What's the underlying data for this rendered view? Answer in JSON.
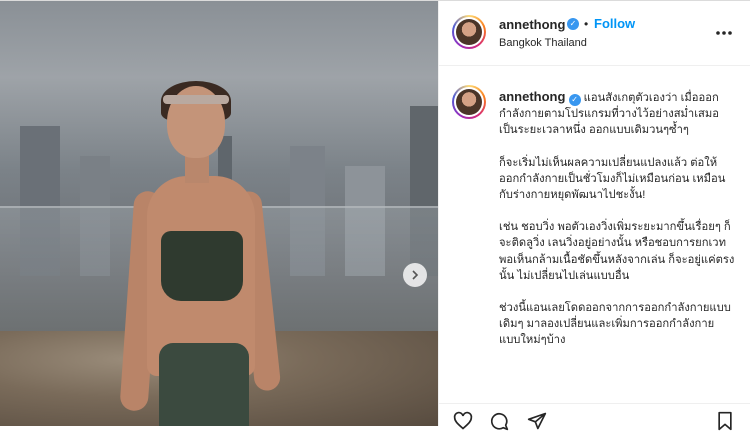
{
  "post": {
    "username": "annethong",
    "follow_label": "Follow",
    "separator": "•",
    "location": "Bangkok Thailand",
    "more_label": "•••"
  },
  "caption": {
    "username": "annethong",
    "p1": "แอนสังเกตุตัวเองว่า เมื่อออกกำลังกายตามโปรแกรมที่วางไว้อย่างสม่ำเสมอเป็นระยะเวลาหนึ่ง ออกแบบเดิมวนๆซ้ำๆ",
    "p2": "ก็จะเริ่มไม่เห็นผลความเปลี่ยนแปลงแล้ว ต่อให้ออกกำลังกายเป็นชั่วโมงก็ไม่เหมือนก่อน เหมือนกับร่างกายหยุดพัฒนาไปชะงั้น!",
    "p3": "เช่น ชอบวิ่ง พอตัวเองวิ่งเพิ่มระยะมากขึ้นเรื่อยๆ ก็จะติดลูวิ่ง เลนวิ่งอยู่อย่างนั้น หรือชอบการยกเวท พอเห็นกล้ามเนื้อชัดขึ้นหลังจากเล่น ก็จะอยู่แค่ตรงนั้น ไม่เปลี่ยนไปเล่นแบบอื่น",
    "p4": "ช่วงนี้แอนเลยโดดออกจากการออกกำลังกายแบบเดิมๆ มาลองเปลี่ยนและเพิ่มการออกกำลังกายแบบใหม่ๆบ้าง"
  },
  "icons": {
    "verified": "verified-badge-icon",
    "next": "chevron-right-icon",
    "like": "heart-icon",
    "comment": "comment-icon",
    "share": "paper-plane-icon",
    "save": "bookmark-icon"
  },
  "colors": {
    "accent": "#0095f6",
    "verified": "#3897f0"
  }
}
